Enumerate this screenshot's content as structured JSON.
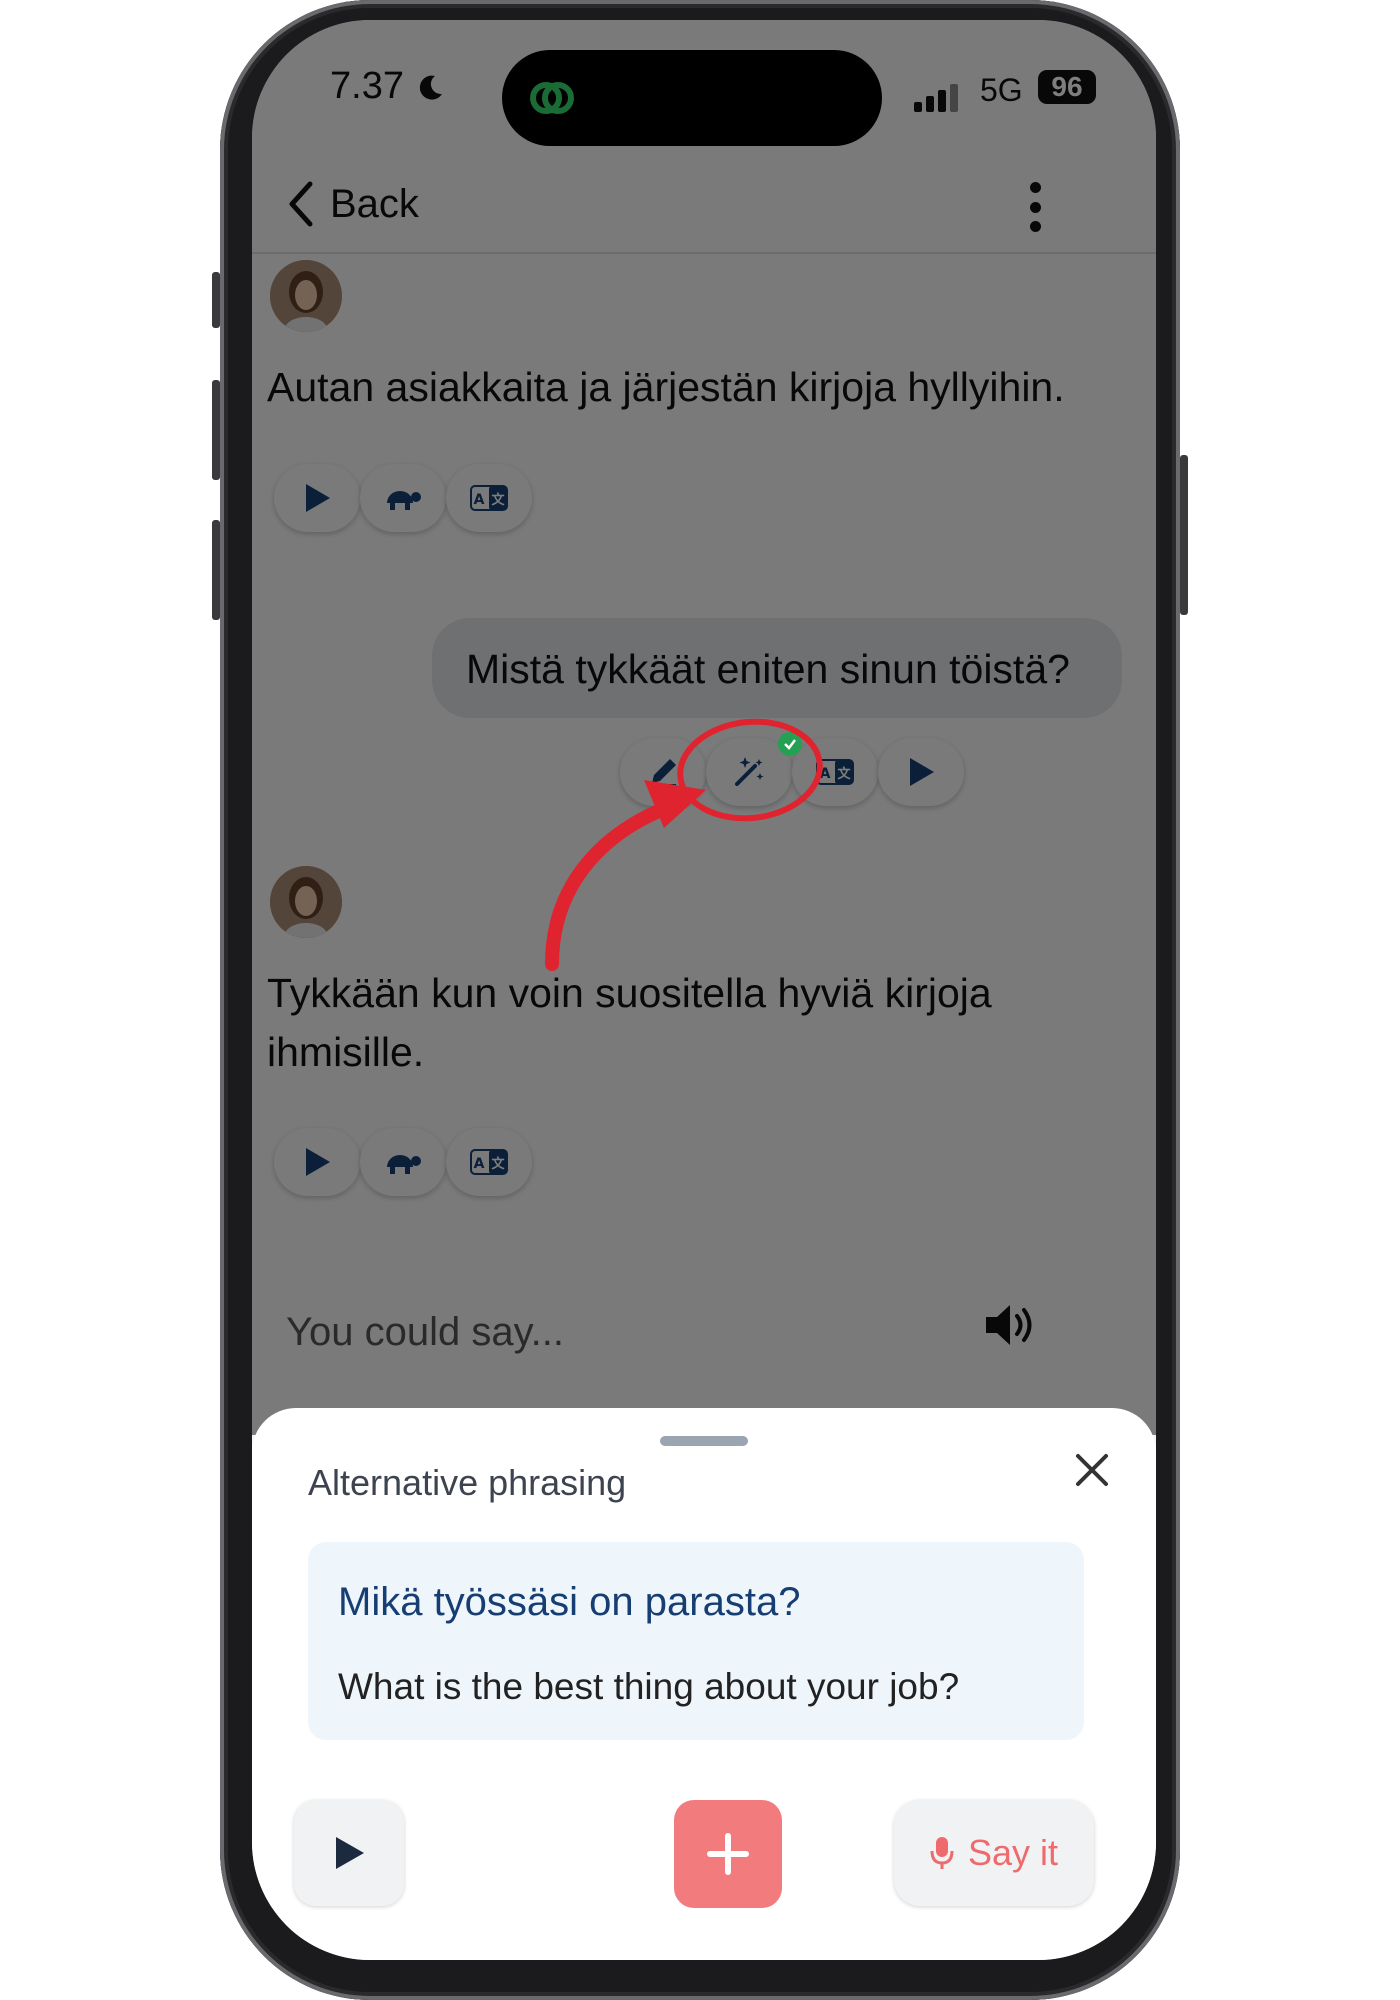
{
  "status_bar": {
    "time": "7.37",
    "network": "5G",
    "battery": "96"
  },
  "nav": {
    "back_label": "Back"
  },
  "conversation": {
    "message_1": "Autan asiakkaita ja järjestän kirjoja hyllyihin.",
    "user_message": "Mistä tykkäät eniten sinun töistä?",
    "message_2": "Tykkään kun voin suositella hyviä kirjoja ihmisille."
  },
  "suggestion": {
    "label": "You could say..."
  },
  "sheet": {
    "title": "Alternative phrasing",
    "finnish": "Mikä työssäsi on parasta?",
    "english": "What is the best thing about your job?",
    "say_it_label": "Say it"
  },
  "colors": {
    "accent_navy": "#163e72",
    "accent_red": "#ef6a6d",
    "plus_button": "#f27b7e",
    "annotation_red": "#e0242f",
    "check_green": "#23a052"
  }
}
